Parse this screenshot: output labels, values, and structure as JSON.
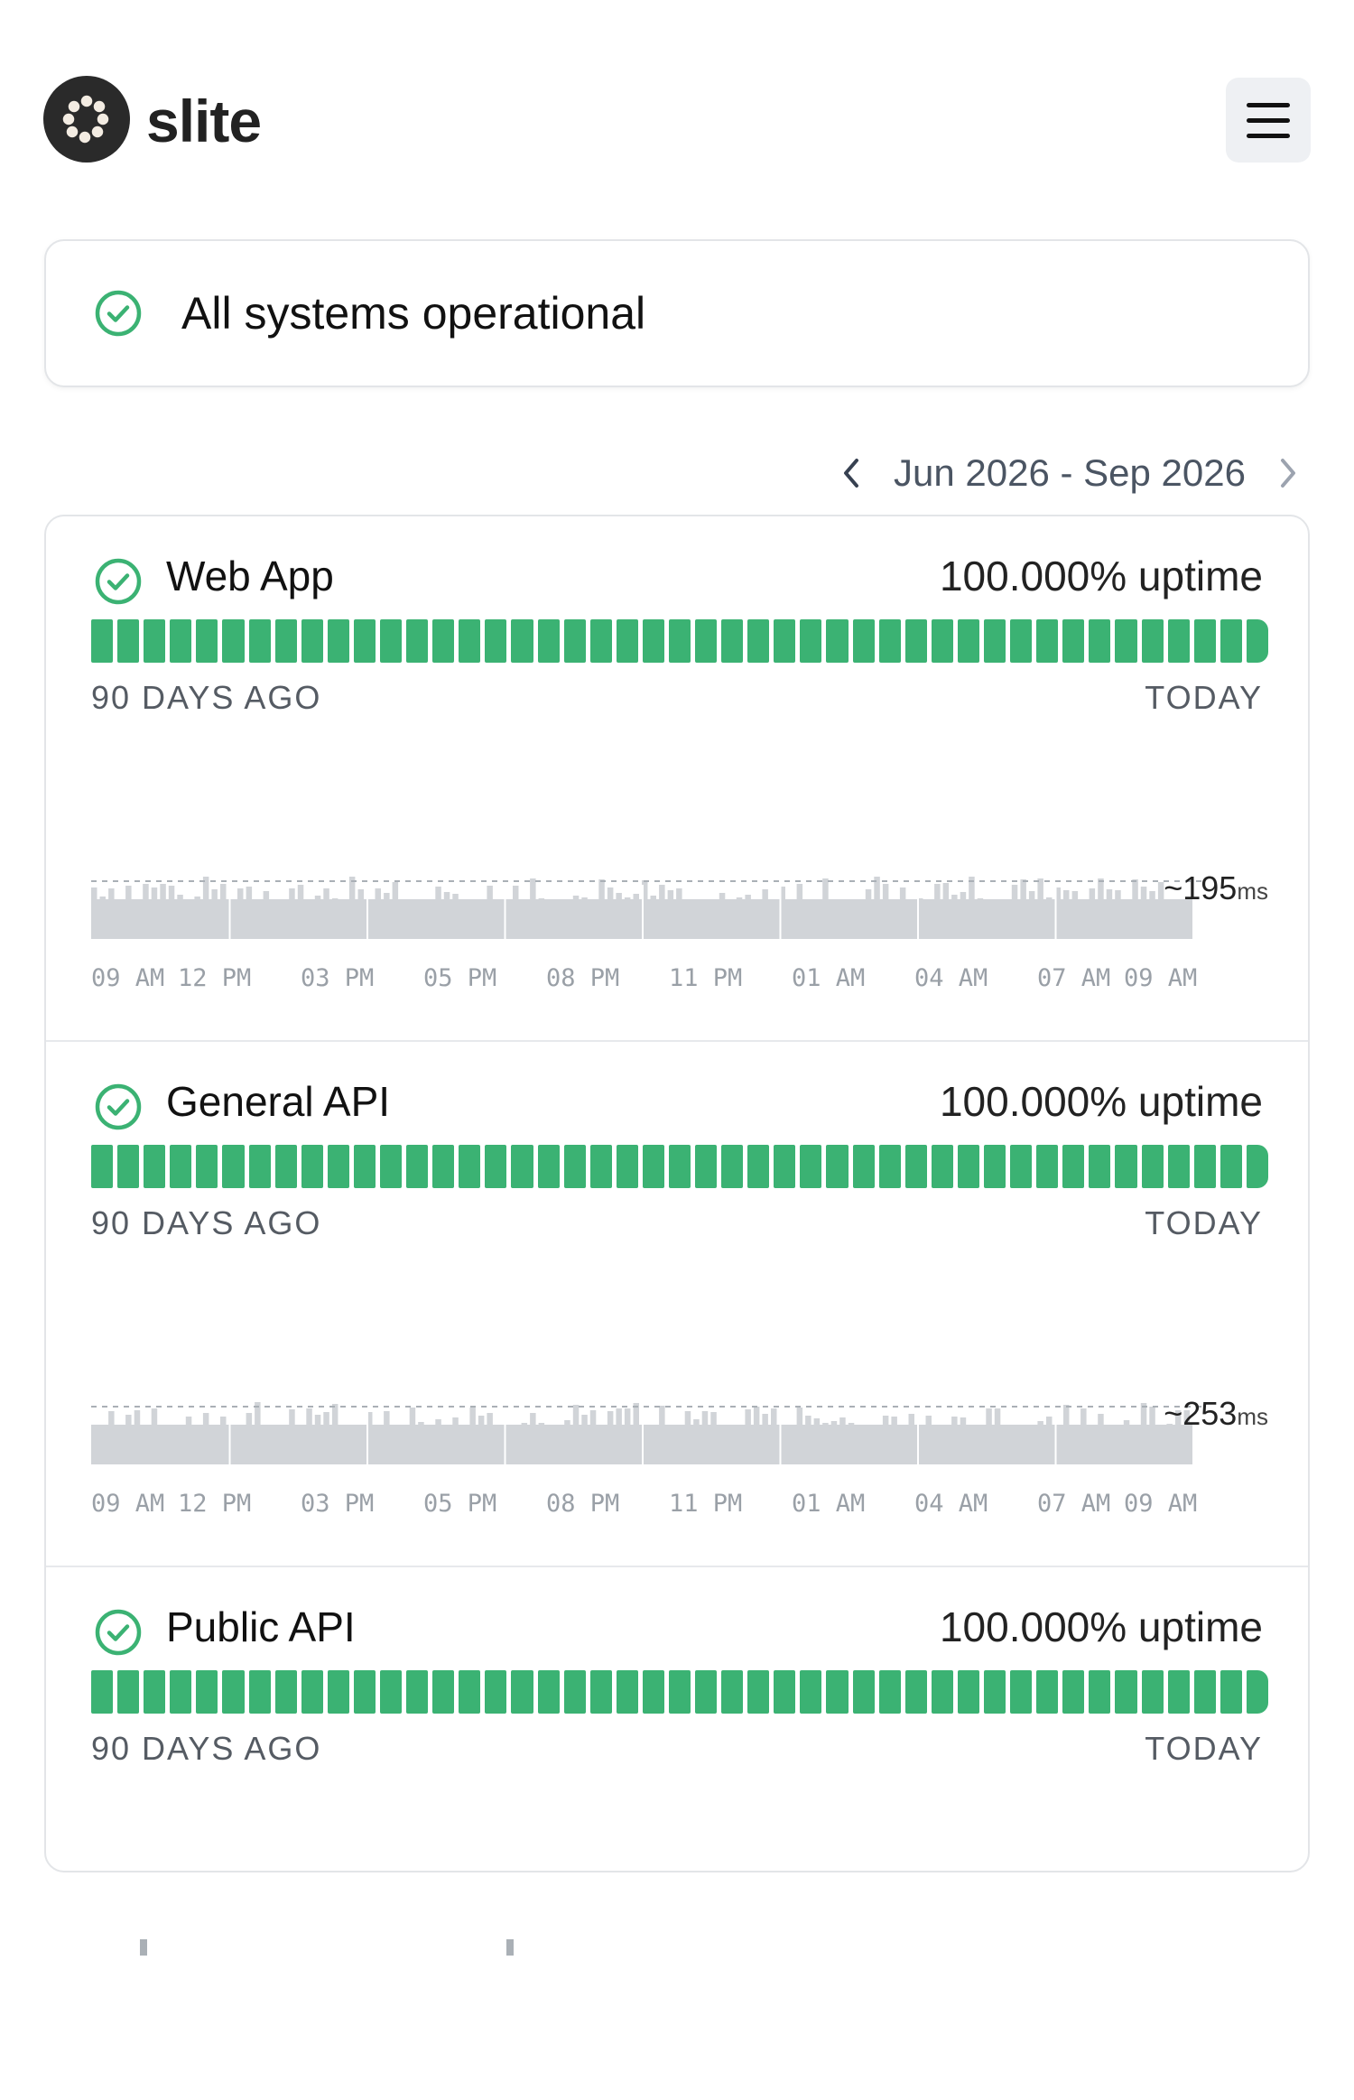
{
  "brand": {
    "name": "slite"
  },
  "status": {
    "text": "All systems operational",
    "color": "#3bb273"
  },
  "date_range": {
    "label": "Jun 2026 - Sep 2026"
  },
  "components": [
    {
      "name": "Web App",
      "uptime": "100.000% uptime",
      "range_start": "90 DAYS AGO",
      "range_end": "TODAY",
      "latency_value": "~195",
      "latency_unit": "ms",
      "time_labels": [
        "09 AM",
        "12 PM",
        "03 PM",
        "05 PM",
        "08 PM",
        "11 PM",
        "01 AM",
        "04 AM",
        "07 AM",
        "09 AM"
      ]
    },
    {
      "name": "General API",
      "uptime": "100.000% uptime",
      "range_start": "90 DAYS AGO",
      "range_end": "TODAY",
      "latency_value": "~253",
      "latency_unit": "ms",
      "time_labels": [
        "09 AM",
        "12 PM",
        "03 PM",
        "05 PM",
        "08 PM",
        "11 PM",
        "01 AM",
        "04 AM",
        "07 AM",
        "09 AM"
      ]
    },
    {
      "name": "Public API",
      "uptime": "100.000% uptime",
      "range_start": "90 DAYS AGO",
      "range_end": "TODAY"
    }
  ],
  "colors": {
    "operational": "#3bb273",
    "latency_bar": "#d1d4d8",
    "text_muted": "#9aa0a7"
  },
  "icons": {
    "menu": "hamburger-icon",
    "status": "check-circle-icon",
    "prev": "chevron-left-icon",
    "next": "chevron-right-icon"
  }
}
